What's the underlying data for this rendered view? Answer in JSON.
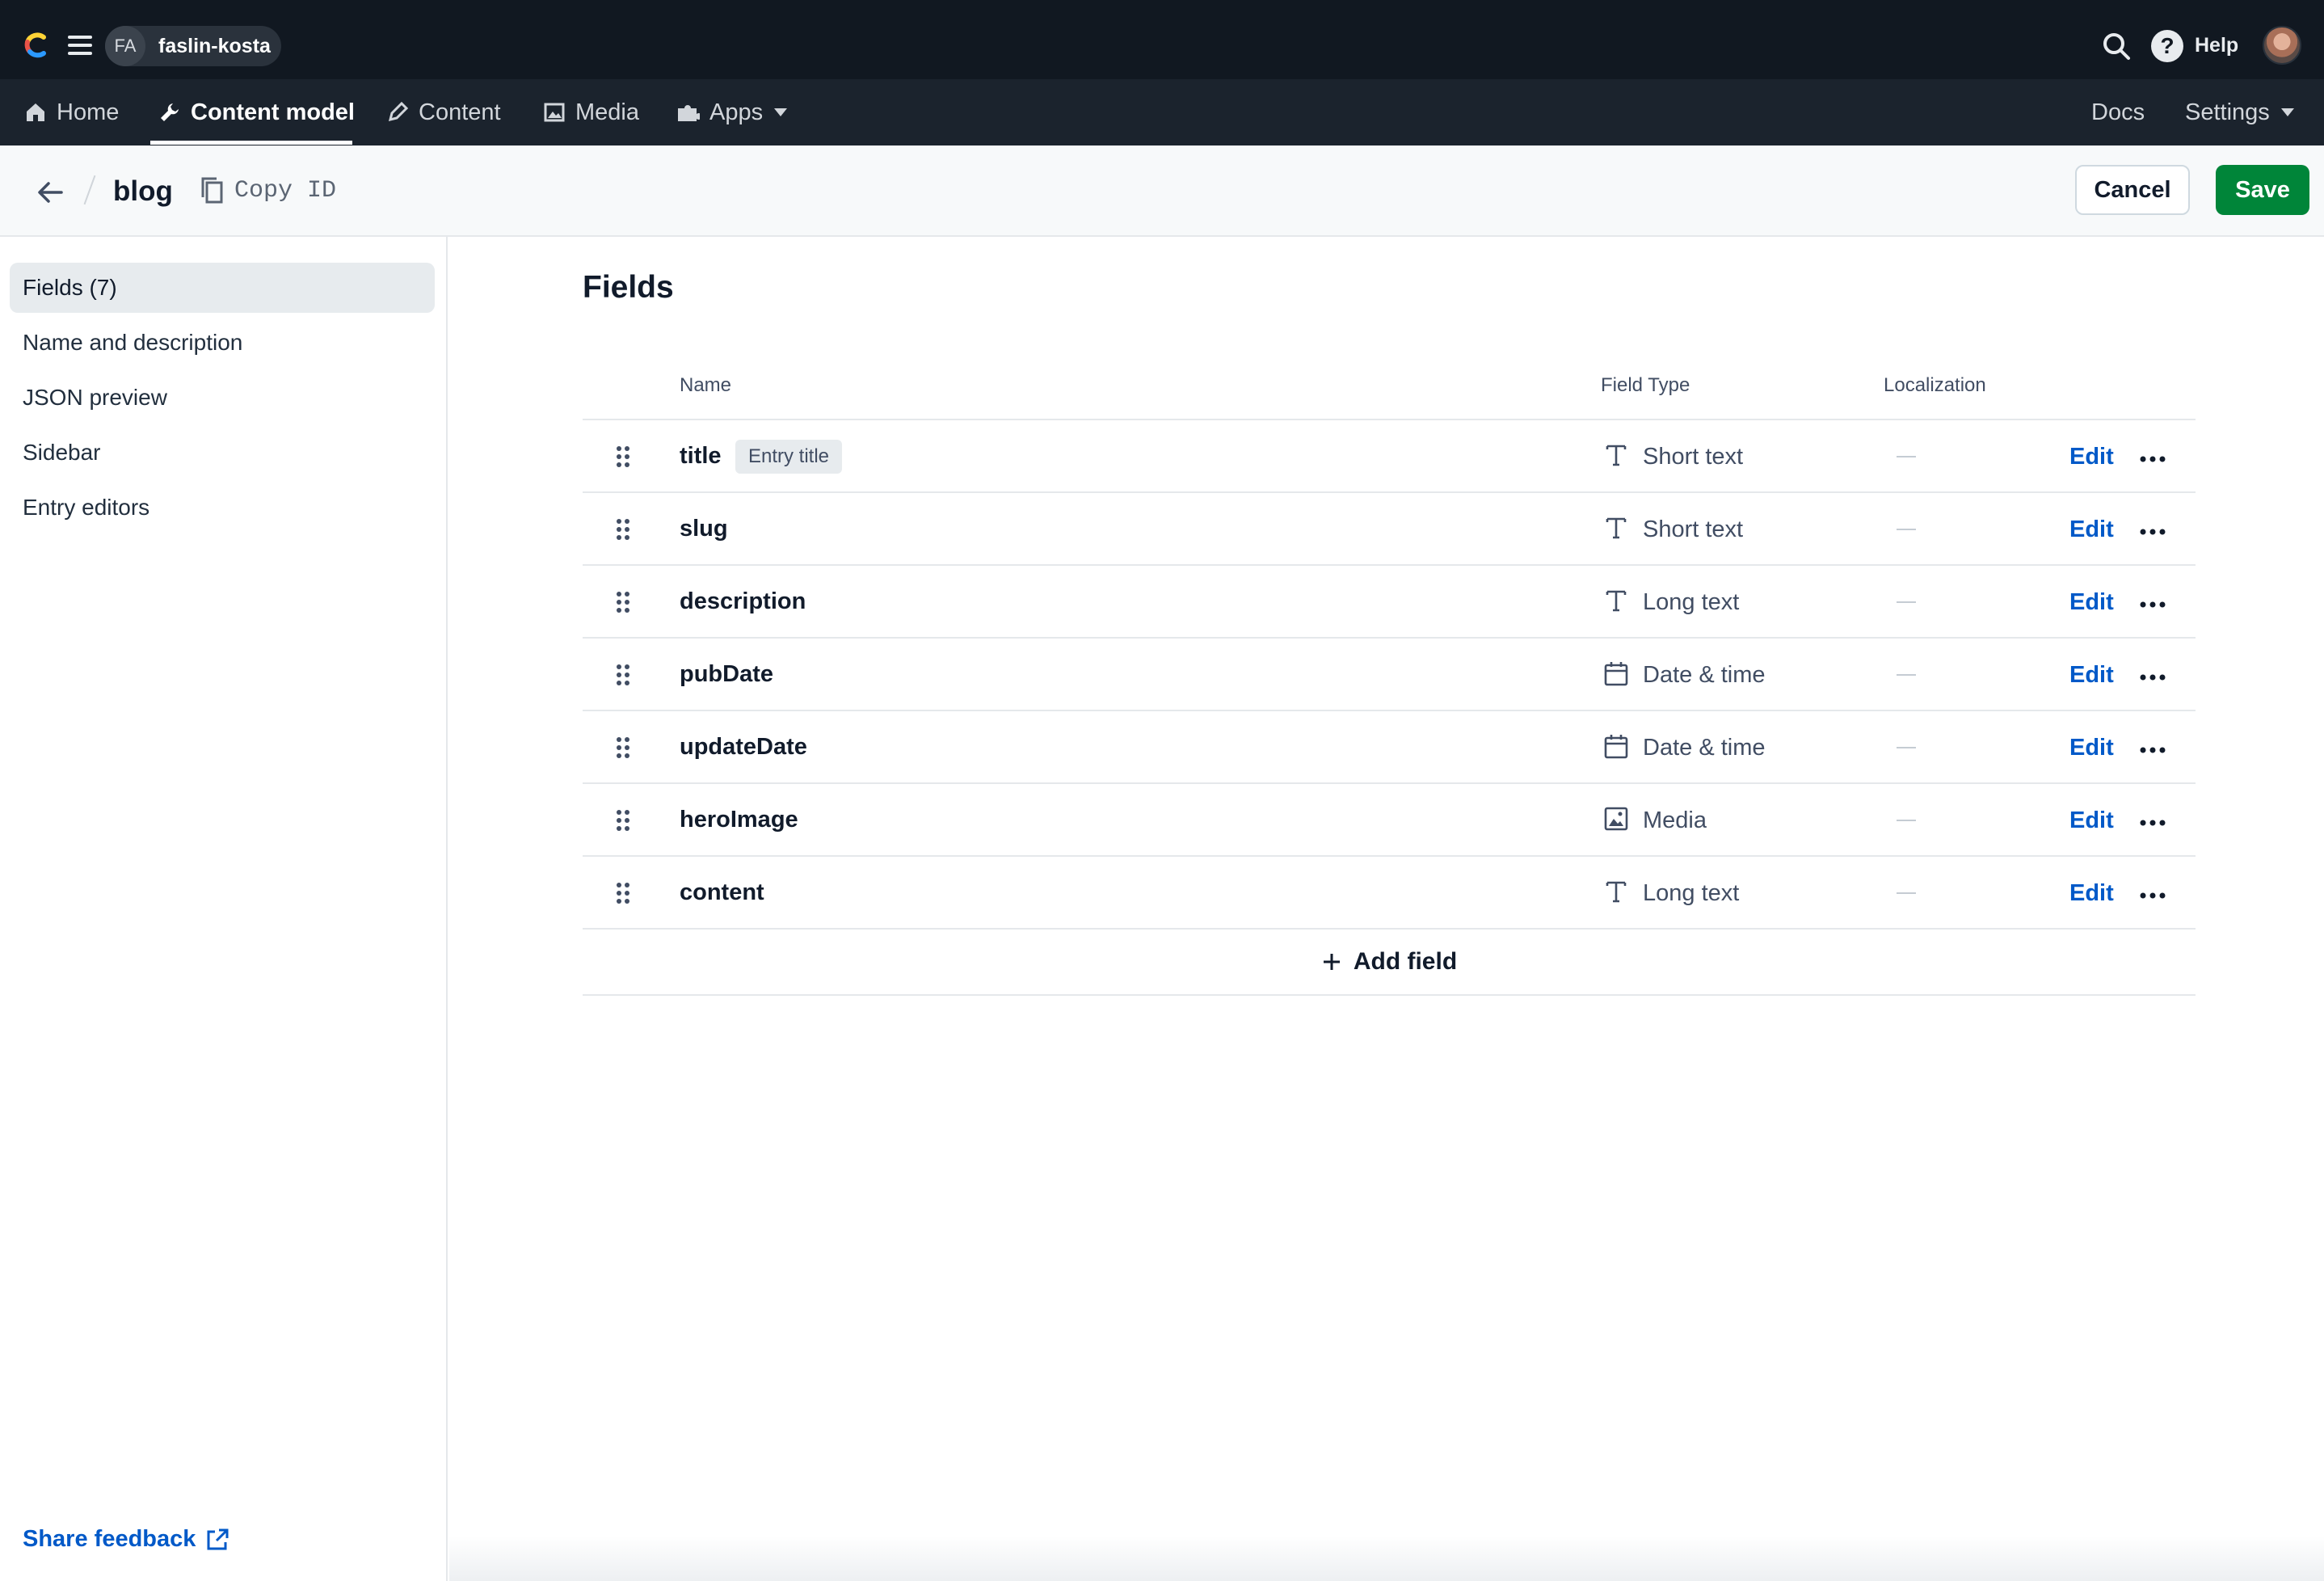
{
  "topbar": {
    "space_initials": "FA",
    "space_name": "faslin-kosta",
    "help_label": "Help"
  },
  "nav": {
    "items": [
      {
        "label": "Home",
        "icon": "home-icon"
      },
      {
        "label": "Content model",
        "icon": "wrench-icon",
        "active": true
      },
      {
        "label": "Content",
        "icon": "pen-icon"
      },
      {
        "label": "Media",
        "icon": "image-icon"
      },
      {
        "label": "Apps",
        "icon": "puzzle-icon"
      }
    ],
    "right": [
      {
        "label": "Docs"
      },
      {
        "label": "Settings"
      }
    ]
  },
  "header": {
    "title": "blog",
    "copy_id_label": "Copy ID",
    "cancel_label": "Cancel",
    "save_label": "Save"
  },
  "sidebar": {
    "items": [
      {
        "label": "Fields (7)",
        "active": true
      },
      {
        "label": "Name and description"
      },
      {
        "label": "JSON preview"
      },
      {
        "label": "Sidebar"
      },
      {
        "label": "Entry editors"
      }
    ],
    "share_feedback": "Share feedback"
  },
  "main": {
    "heading": "Fields",
    "columns": {
      "name": "Name",
      "field_type": "Field Type",
      "localization": "Localization"
    },
    "rows": [
      {
        "name": "title",
        "badge": "Entry title",
        "type": "Short text",
        "type_icon": "text-icon",
        "edit": "Edit"
      },
      {
        "name": "slug",
        "type": "Short text",
        "type_icon": "text-icon",
        "edit": "Edit"
      },
      {
        "name": "description",
        "type": "Long text",
        "type_icon": "text-icon",
        "edit": "Edit"
      },
      {
        "name": "pubDate",
        "type": "Date & time",
        "type_icon": "calendar-icon",
        "edit": "Edit"
      },
      {
        "name": "updateDate",
        "type": "Date & time",
        "type_icon": "calendar-icon",
        "edit": "Edit"
      },
      {
        "name": "heroImage",
        "type": "Media",
        "type_icon": "image-icon",
        "edit": "Edit"
      },
      {
        "name": "content",
        "type": "Long text",
        "type_icon": "text-icon",
        "edit": "Edit"
      }
    ],
    "add_field_label": "Add field"
  },
  "colors": {
    "topbar_bg": "#111821",
    "navbar_bg": "#1b232d",
    "accent_blue": "#0059c8",
    "save_green": "#008539"
  }
}
